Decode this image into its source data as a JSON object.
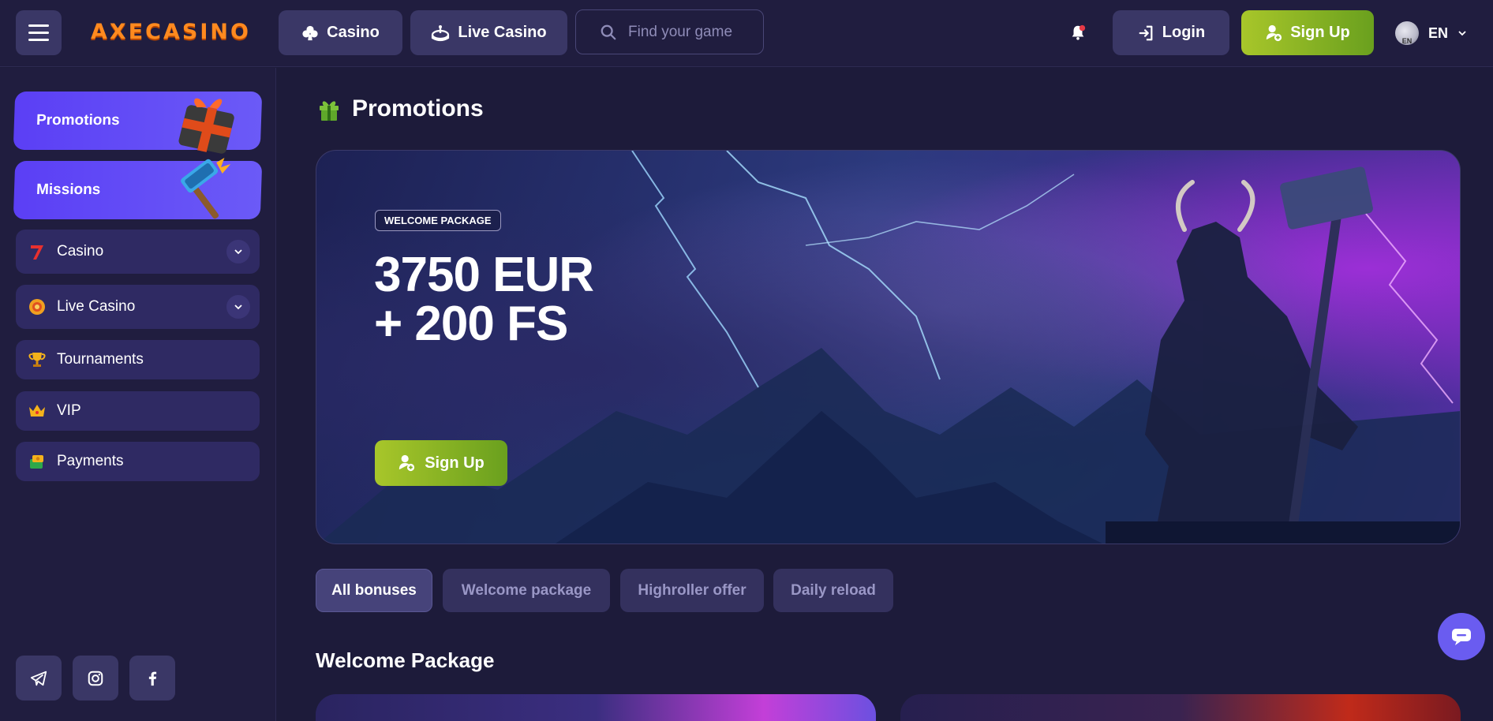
{
  "header": {
    "logo": "AXECASINO",
    "nav": [
      {
        "label": "Casino",
        "icon": "club-icon"
      },
      {
        "label": "Live Casino",
        "icon": "roulette-icon"
      }
    ],
    "search_placeholder": "Find your game",
    "login_label": "Login",
    "signup_label": "Sign Up",
    "language": "EN",
    "globe_text": "EN"
  },
  "sidebar": {
    "featured": [
      {
        "label": "Promotions"
      },
      {
        "label": "Missions"
      }
    ],
    "items": [
      {
        "label": "Casino",
        "icon": "seven-icon",
        "expandable": true
      },
      {
        "label": "Live Casino",
        "icon": "chip-icon",
        "expandable": true
      },
      {
        "label": "Tournaments",
        "icon": "trophy-icon",
        "expandable": false
      },
      {
        "label": "VIP",
        "icon": "crown-icon",
        "expandable": false
      },
      {
        "label": "Payments",
        "icon": "coins-icon",
        "expandable": false
      }
    ],
    "social": [
      "telegram-icon",
      "instagram-icon",
      "facebook-icon"
    ]
  },
  "main": {
    "page_title": "Promotions",
    "hero": {
      "badge": "WELCOME PACKAGE",
      "line1": "3750 EUR",
      "line2": "+ 200 FS",
      "cta": "Sign Up"
    },
    "filters": [
      {
        "label": "All bonuses",
        "active": true
      },
      {
        "label": "Welcome package",
        "active": false
      },
      {
        "label": "Highroller offer",
        "active": false
      },
      {
        "label": "Daily reload",
        "active": false
      }
    ],
    "section_title": "Welcome Package"
  },
  "colors": {
    "background": "#1d1b3a",
    "accent_purple": "#5b3ff5",
    "signup_green": "#a8c62a",
    "logo_orange": "#ff8a1f"
  }
}
